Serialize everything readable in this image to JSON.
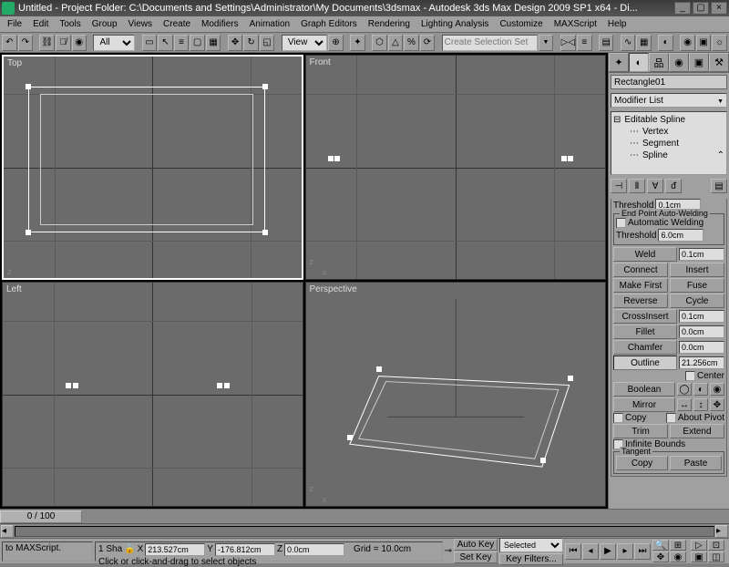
{
  "title": "Untitled    - Project Folder: C:\\Documents and Settings\\Administrator\\My Documents\\3dsmax   - Autodesk 3ds Max Design 2009 SP1  x64    - Di...",
  "menu": [
    "File",
    "Edit",
    "Tools",
    "Group",
    "Views",
    "Create",
    "Modifiers",
    "Animation",
    "Graph Editors",
    "Rendering",
    "Lighting Analysis",
    "Customize",
    "MAXScript",
    "Help"
  ],
  "toolbar": {
    "layer_drop": "All",
    "view_drop": "View",
    "selset_placeholder": "Create Selection Set"
  },
  "viewports": {
    "top": "Top",
    "front": "Front",
    "left": "Left",
    "persp": "Perspective"
  },
  "panel": {
    "object_name": "Rectangle01",
    "modlist_label": "Modifier List",
    "stack": {
      "root": "Editable Spline",
      "subs": [
        "Vertex",
        "Segment",
        "Spline"
      ]
    },
    "threshold_label": "Threshold",
    "threshold_val": "0.1cm",
    "epaw_title": "End Point Auto-Welding",
    "auto_weld": "Automatic Welding",
    "auto_thresh_label": "Threshold",
    "auto_thresh_val": "6.0cm",
    "weld": "Weld",
    "weld_val": "0.1cm",
    "connect": "Connect",
    "insert": "Insert",
    "makefirst": "Make First",
    "fuse": "Fuse",
    "reverse": "Reverse",
    "cycle": "Cycle",
    "crossinsert": "CrossInsert",
    "cross_val": "0.1cm",
    "fillet": "Fillet",
    "fillet_val": "0.0cm",
    "chamfer": "Chamfer",
    "chamfer_val": "0.0cm",
    "outline": "Outline",
    "outline_val": "21.256cm",
    "center": "Center",
    "boolean": "Boolean",
    "mirror": "Mirror",
    "copy": "Copy",
    "about_pivot": "About Pivot",
    "trim": "Trim",
    "extend": "Extend",
    "infinite": "Infinite Bounds",
    "tangent": "Tangent",
    "copy2": "Copy",
    "paste": "Paste"
  },
  "timeline": {
    "slider": "0 / 100"
  },
  "status": {
    "maxscript": "to MAXScript.",
    "sel": "1 Sha",
    "x": "213.527cm",
    "y": "-176.812cm",
    "z": "0.0cm",
    "grid": "Grid = 10.0cm",
    "autokey": "Auto Key",
    "setkey": "Set Key",
    "selected": "Selected",
    "keyfilters": "Key Filters...",
    "prompt": "Click or click-and-drag to select objects"
  }
}
